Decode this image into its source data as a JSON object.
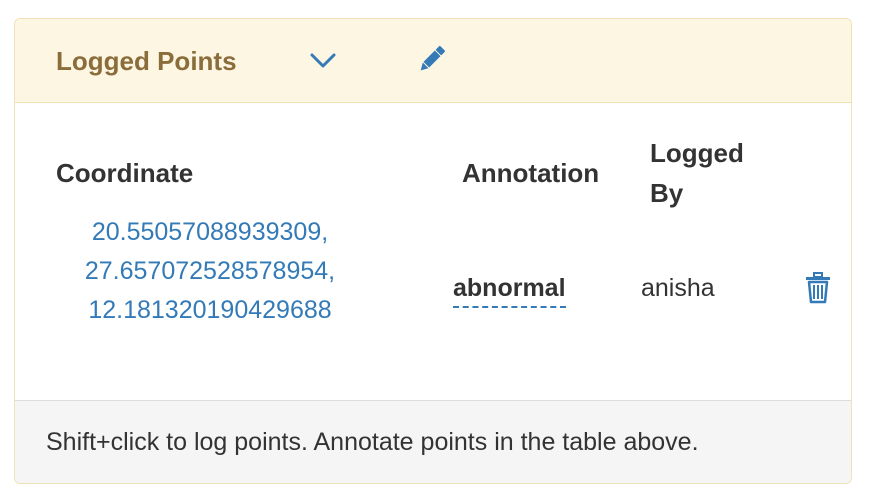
{
  "panel": {
    "title": "Logged Points",
    "icons": {
      "toggle": "chevron-down-icon",
      "edit": "pencil-icon",
      "delete": "trash-icon"
    },
    "colors": {
      "header_bg": "#fcf6e2",
      "title": "#8a6d3b",
      "link": "#337ab7",
      "footer_bg": "#f5f5f5"
    }
  },
  "table": {
    "headers": {
      "coordinate": "Coordinate",
      "annotation": "Annotation",
      "logged_by": "Logged By"
    },
    "rows": [
      {
        "coordinate": [
          "20.55057088939309,",
          "27.657072528578954,",
          "12.181320190429688"
        ],
        "annotation": "abnormal",
        "logged_by": "anisha"
      }
    ]
  },
  "footer": {
    "text": "Shift+click to log points. Annotate points in the table above."
  }
}
